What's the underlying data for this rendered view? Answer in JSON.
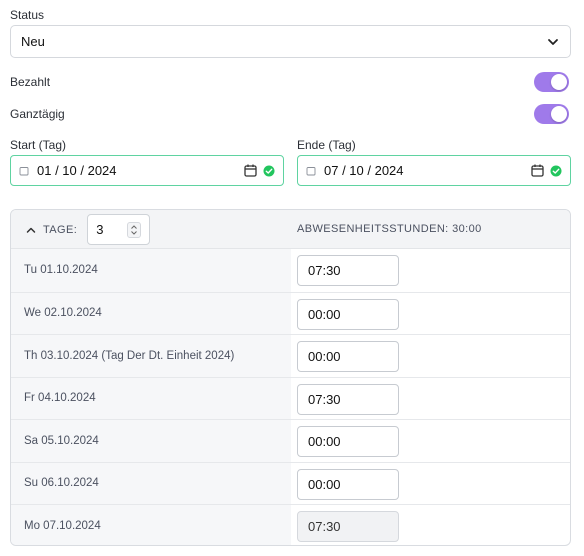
{
  "status": {
    "label": "Status",
    "value": "Neu"
  },
  "bezahlt": {
    "label": "Bezahlt",
    "on": true
  },
  "ganztaegig": {
    "label": "Ganztägig",
    "on": true
  },
  "start": {
    "label": "Start (Tag)",
    "value": "01 / 10 / 2024"
  },
  "ende": {
    "label": "Ende (Tag)",
    "value": "07 / 10 / 2024"
  },
  "panel": {
    "tage_label": "TAGE:",
    "tage_value": "3",
    "abwesenheitsstunden": "ABWESENHEITSSTUNDEN: 30:00"
  },
  "days": [
    {
      "date": "Tu 01.10.2024",
      "time": "07:30",
      "editable": true
    },
    {
      "date": "We 02.10.2024",
      "time": "00:00",
      "editable": true
    },
    {
      "date": "Th 03.10.2024 (Tag Der Dt. Einheit 2024)",
      "time": "00:00",
      "editable": true
    },
    {
      "date": "Fr 04.10.2024",
      "time": "07:30",
      "editable": true
    },
    {
      "date": "Sa 05.10.2024",
      "time": "00:00",
      "editable": true
    },
    {
      "date": "Su 06.10.2024",
      "time": "00:00",
      "editable": true
    },
    {
      "date": "Mo 07.10.2024",
      "time": "07:30",
      "editable": false
    }
  ],
  "colors": {
    "accent": "#9f7aea",
    "success": "#22c55e",
    "valid_border": "#5fd3a1"
  },
  "icons": {
    "select": "chevron-down-icon",
    "date": "calendar-icon",
    "valid": "check-circle-icon",
    "collapse": "chevron-up-icon"
  }
}
